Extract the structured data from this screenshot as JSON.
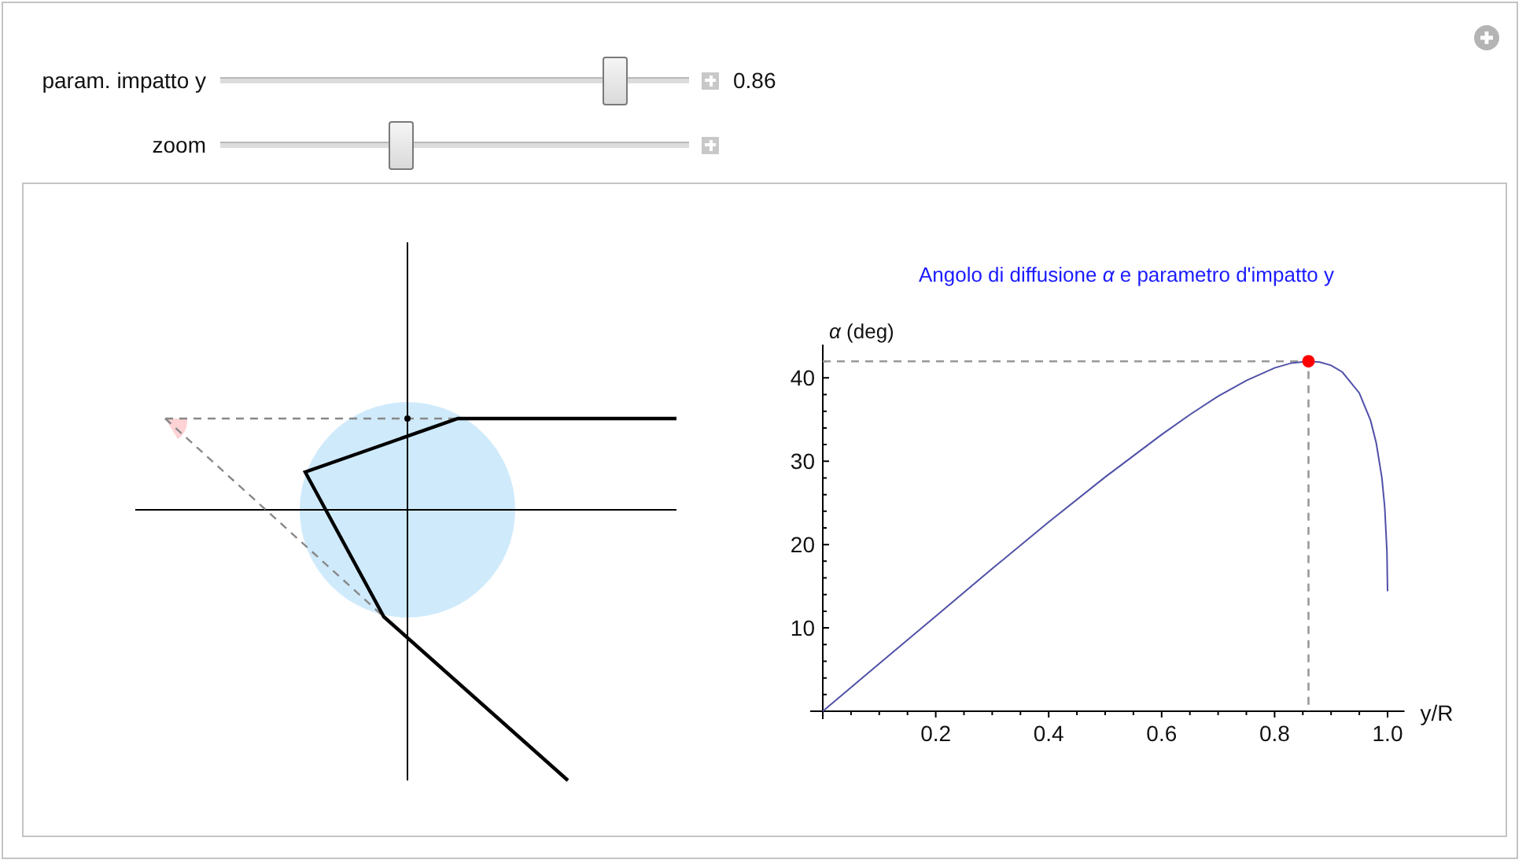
{
  "controls": [
    {
      "label": "param. impatto y",
      "level": 0.86,
      "value": "0.86"
    },
    {
      "label": "zoom",
      "level": 0.38
    }
  ],
  "plot": {
    "chart_title": "Angolo di diffusione *α* e parametro d'impatto y",
    "chart_data": {
      "type": "line",
      "ylabel": "*α* (deg)",
      "xlabel": "y/R",
      "xlim": [
        0,
        1.03
      ],
      "ylim": [
        0,
        44
      ],
      "xticks": [
        0.2,
        0.4,
        0.6,
        0.8,
        {
          "value": 1,
          "label": "1.0"
        }
      ],
      "yticks": [
        10,
        20,
        30,
        40
      ],
      "x": [
        0,
        0.1,
        0.2,
        0.3,
        0.4,
        0.5,
        0.6,
        0.65,
        0.7,
        0.75,
        0.8,
        0.83,
        0.86,
        0.88,
        0.9,
        0.92,
        0.95,
        0.97,
        0.98,
        0.99,
        0.995,
        0.999,
        1
      ],
      "series": [
        {
          "color": "#5050a8",
          "values": [
            0,
            5.7,
            11.4,
            17.1,
            22.7,
            28.1,
            33.2,
            35.6,
            37.8,
            39.7,
            41.2,
            41.8,
            42,
            41.9,
            41.5,
            40.7,
            38.2,
            34.9,
            32.2,
            28,
            24.5,
            19.2,
            14.4
          ]
        }
      ]
    }
  }
}
